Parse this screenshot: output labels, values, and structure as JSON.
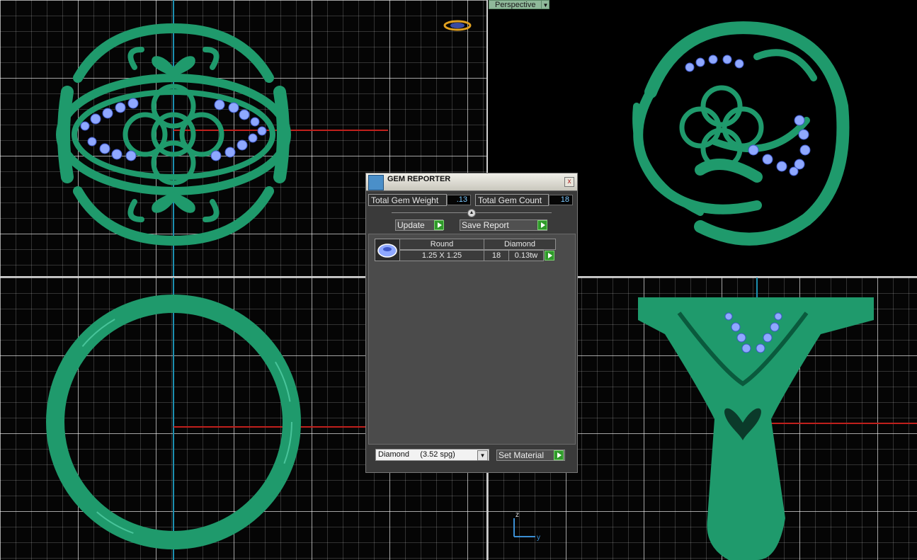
{
  "viewport": {
    "label": "Perspective"
  },
  "axes": {
    "z": "z",
    "y": "y"
  },
  "panel": {
    "title": "GEM REPORTER",
    "close": "x",
    "total_weight_label": "Total Gem Weight",
    "total_weight_value": ".13",
    "total_count_label": "Total Gem Count",
    "total_count_value": "18",
    "update_label": "Update",
    "save_label": "Save Report",
    "table": {
      "shape": "Round",
      "size": "1.25 X 1.25",
      "material": "Diamond",
      "count": "18",
      "weight": "0.13tw"
    },
    "material_select": "Diamond     (3.52 spg)",
    "set_material_label": "Set Material"
  },
  "colors": {
    "model": "#1f9a6c",
    "gem": "#8fa8ff",
    "accent_green": "#2f9a2a"
  }
}
